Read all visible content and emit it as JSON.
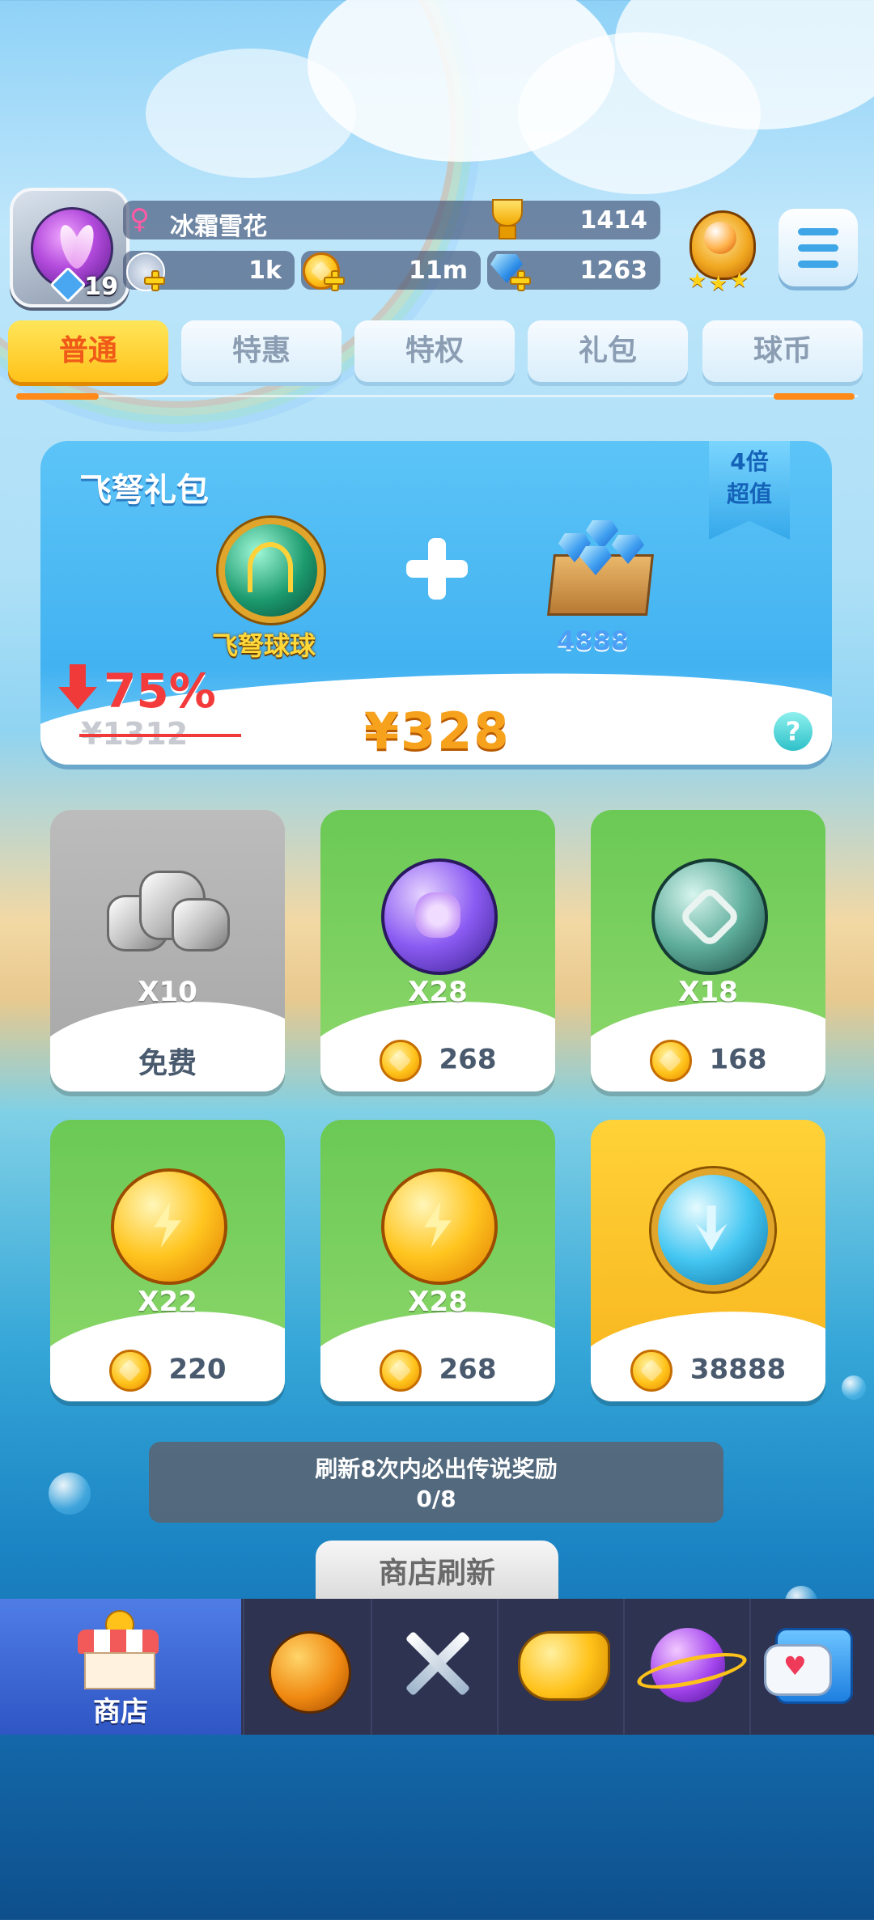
{
  "header": {
    "player_name": "冰霜雪花",
    "level": "19",
    "trophies": "1414",
    "stars": "1k",
    "coins": "11m",
    "gems": "1263"
  },
  "tabs": [
    {
      "label": "普通",
      "active": true
    },
    {
      "label": "特惠",
      "active": false
    },
    {
      "label": "特权",
      "active": false
    },
    {
      "label": "礼包",
      "active": false
    },
    {
      "label": "球币",
      "active": false
    }
  ],
  "gift_pack": {
    "title": "飞弩礼包",
    "badge_line1": "4倍",
    "badge_line2": "超值",
    "item1_name": "飞弩球球",
    "item2_amount": "4888",
    "discount": "75%",
    "original_price": "¥1312",
    "price": "¥328",
    "help": "?"
  },
  "items": [
    {
      "icon": "stone-icon",
      "quantity": "X10",
      "cost": "免费",
      "free": true,
      "color": "#a9a9a9"
    },
    {
      "icon": "clover-orb-icon",
      "quantity": "X28",
      "cost": "268",
      "free": false,
      "color": "#79cf5e"
    },
    {
      "icon": "chain-orb-icon",
      "quantity": "X18",
      "cost": "168",
      "free": false,
      "color": "#79cf5e"
    },
    {
      "icon": "lightning-orb-icon",
      "quantity": "X22",
      "cost": "220",
      "free": false,
      "color": "#79cf5e"
    },
    {
      "icon": "lightning-orb-icon",
      "quantity": "X28",
      "cost": "268",
      "free": false,
      "color": "#79cf5e"
    },
    {
      "icon": "legendary-orb-icon",
      "quantity": "",
      "cost": "38888",
      "free": false,
      "color": "#f9bf26"
    }
  ],
  "refresh": {
    "info": "刷新8次内必出传说奖励",
    "progress": "0/8",
    "button": "商店刷新"
  },
  "bottom_nav": [
    {
      "label": "商店",
      "icon": "shop-icon",
      "active": true
    },
    {
      "label": "",
      "icon": "ball-bag-icon",
      "active": false
    },
    {
      "label": "",
      "icon": "crossed-swords-icon",
      "active": false
    },
    {
      "label": "",
      "icon": "whistle-icon",
      "active": false
    },
    {
      "label": "",
      "icon": "planet-icon",
      "active": false
    },
    {
      "label": "",
      "icon": "chat-icon",
      "active": false
    }
  ],
  "colors": {
    "accent_orange": "#ff8a1a",
    "price_orange": "#f7a21c",
    "discount_red": "#f33b3b",
    "nav_bg": "#2e3352",
    "nav_active": "#3f6ad6"
  }
}
